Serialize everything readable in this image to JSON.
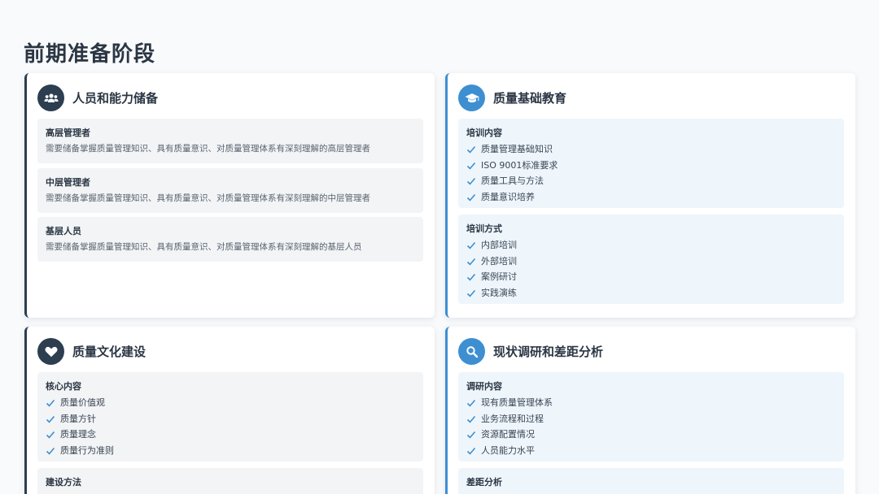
{
  "page": {
    "title": "前期准备阶段"
  },
  "colors": {
    "dark_accent": "#2c3e50",
    "blue_accent": "#3d8fd1"
  },
  "cards": [
    {
      "title": "人员和能力储备",
      "icon": "users-icon",
      "boxes": [
        {
          "title": "高层管理者",
          "desc": "需要储备掌握质量管理知识、具有质量意识、对质量管理体系有深刻理解的高层管理者"
        },
        {
          "title": "中层管理者",
          "desc": "需要储备掌握质量管理知识、具有质量意识、对质量管理体系有深刻理解的中层管理者"
        },
        {
          "title": "基层人员",
          "desc": "需要储备掌握质量管理知识、具有质量意识、对质量管理体系有深刻理解的基层人员"
        }
      ]
    },
    {
      "title": "质量基础教育",
      "icon": "graduation-cap-icon",
      "boxes": [
        {
          "title": "培训内容",
          "items": [
            "质量管理基础知识",
            "ISO 9001标准要求",
            "质量工具与方法",
            "质量意识培养"
          ]
        },
        {
          "title": "培训方式",
          "items": [
            "内部培训",
            "外部培训",
            "案例研讨",
            "实践演练"
          ]
        }
      ]
    },
    {
      "title": "质量文化建设",
      "icon": "heart-icon",
      "boxes": [
        {
          "title": "核心内容",
          "items": [
            "质量价值观",
            "质量方针",
            "质量理念",
            "质量行为准则"
          ]
        },
        {
          "title": "建设方法",
          "items": []
        }
      ]
    },
    {
      "title": "现状调研和差距分析",
      "icon": "search-icon",
      "boxes": [
        {
          "title": "调研内容",
          "items": [
            "现有质量管理体系",
            "业务流程和过程",
            "资源配置情况",
            "人员能力水平"
          ]
        },
        {
          "title": "差距分析",
          "items": []
        }
      ]
    }
  ]
}
